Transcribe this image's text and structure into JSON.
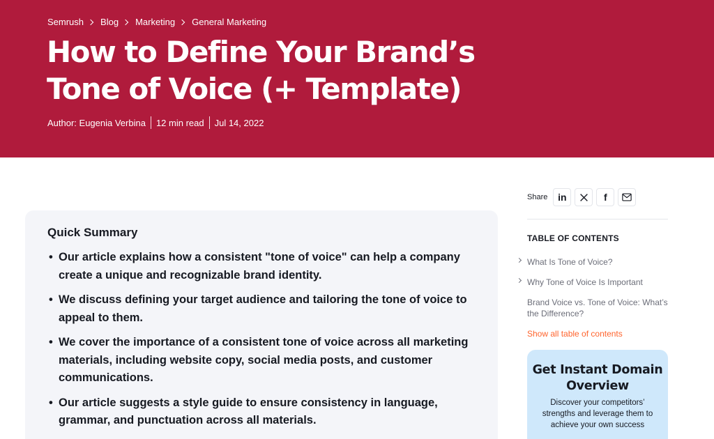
{
  "breadcrumb": [
    "Semrush",
    "Blog",
    "Marketing",
    "General Marketing"
  ],
  "article": {
    "title_line1": "How to Define Your Brand’s",
    "title_line2": "Tone of Voice (+ Template)",
    "author": "Author: Eugenia Verbina",
    "read_time": "12 min read",
    "date": "Jul 14, 2022"
  },
  "summary": {
    "title": "Quick Summary",
    "items": [
      "Our article explains how a consistent \"tone of voice\" can help a company create a unique and recognizable brand identity.",
      "We discuss defining your target audience and tailoring the tone of voice to appeal to them.",
      "We cover the importance of a consistent tone of voice across all marketing materials, including website copy, social media posts, and customer communications.",
      "Our article suggests a style guide to ensure consistency in language, grammar, and punctuation across all materials."
    ]
  },
  "share": {
    "label": "Share",
    "buttons": [
      {
        "icon": "linkedin-icon",
        "glyph": "in"
      },
      {
        "icon": "x-icon",
        "glyph": "𝕏"
      },
      {
        "icon": "facebook-icon",
        "glyph": "f"
      },
      {
        "icon": "email-icon",
        "glyph": ""
      }
    ]
  },
  "toc": {
    "heading": "TABLE OF CONTENTS",
    "items": [
      "What Is Tone of Voice?",
      "Why Tone of Voice Is Important",
      "Brand Voice vs. Tone of Voice: What’s the Difference?"
    ],
    "show_all": "Show all table of contents"
  },
  "promo": {
    "title": "Get Instant Domain Overview",
    "text": "Discover your competitors’ strengths and leverage them to achieve your own success"
  },
  "colors": {
    "hero_bg": "#b01b3c",
    "summary_bg": "#f4f5f9",
    "promo_bg": "#cfe8fb",
    "link_accent": "#ff642d"
  }
}
